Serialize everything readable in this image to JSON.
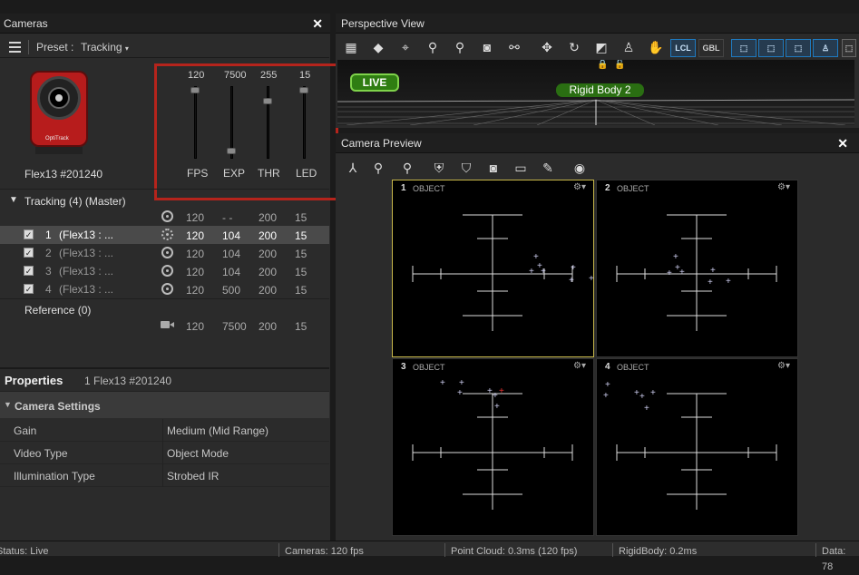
{
  "cameras_panel": {
    "title": "Cameras",
    "close": "✕",
    "preset_label": "Preset :",
    "preset_value": "Tracking",
    "device_name": "Flex13 #201240",
    "brand": "OptiTrack",
    "sliders": [
      {
        "label": "FPS",
        "value": "120",
        "level": 1.0
      },
      {
        "label": "EXP",
        "value": "7500",
        "level": 0.05
      },
      {
        "label": "THR",
        "value": "255",
        "level": 0.83
      },
      {
        "label": "LED",
        "value": "15",
        "level": 1.0
      }
    ],
    "group_title": "Tracking (4) (Master)",
    "group_row": {
      "fps": "120",
      "exp": "- -",
      "thr": "200",
      "led": "15"
    },
    "camera_rows": [
      {
        "num": "1",
        "name": "(Flex13 : ...",
        "fps": "120",
        "exp": "104",
        "thr": "200",
        "led": "15",
        "selected": true
      },
      {
        "num": "2",
        "name": "(Flex13 : ...",
        "fps": "120",
        "exp": "104",
        "thr": "200",
        "led": "15",
        "selected": false
      },
      {
        "num": "3",
        "name": "(Flex13 : ...",
        "fps": "120",
        "exp": "104",
        "thr": "200",
        "led": "15",
        "selected": false
      },
      {
        "num": "4",
        "name": "(Flex13 : ...",
        "fps": "120",
        "exp": "500",
        "thr": "200",
        "led": "15",
        "selected": false
      }
    ],
    "reference_title": "Reference (0)",
    "reference_row": {
      "fps": "120",
      "exp": "7500",
      "thr": "200",
      "led": "15"
    }
  },
  "properties": {
    "title": "Properties",
    "subtitle": "1 Flex13 #201240",
    "section": "Camera Settings",
    "rows": [
      {
        "key": "Gain",
        "value": "Medium (Mid Range)"
      },
      {
        "key": "Video Type",
        "value": "Object Mode"
      },
      {
        "key": "Illumination Type",
        "value": "Strobed IR"
      }
    ]
  },
  "perspective": {
    "title": "Perspective View",
    "live": "LIVE",
    "rigid_body": "Rigid Body 2",
    "lcl": "LCL",
    "gbl": "GBL"
  },
  "preview": {
    "title": "Camera Preview",
    "close": "✕",
    "cells": [
      {
        "num": "1",
        "label": "OBJECT"
      },
      {
        "num": "2",
        "label": "OBJECT"
      },
      {
        "num": "3",
        "label": "OBJECT"
      },
      {
        "num": "4",
        "label": "OBJECT"
      }
    ]
  },
  "status": {
    "status": "Status: Live",
    "cameras": "Cameras: 120 fps",
    "point_cloud": "Point Cloud: 0.3ms (120 fps)",
    "rigidbody": "RigidBody: 0.2ms",
    "data": "Data: 78"
  },
  "colors": {
    "accent": "#1f7ac0",
    "highlight_box": "#b5241c",
    "live": "#3a8a1e",
    "active_cell": "#c8b84a"
  }
}
